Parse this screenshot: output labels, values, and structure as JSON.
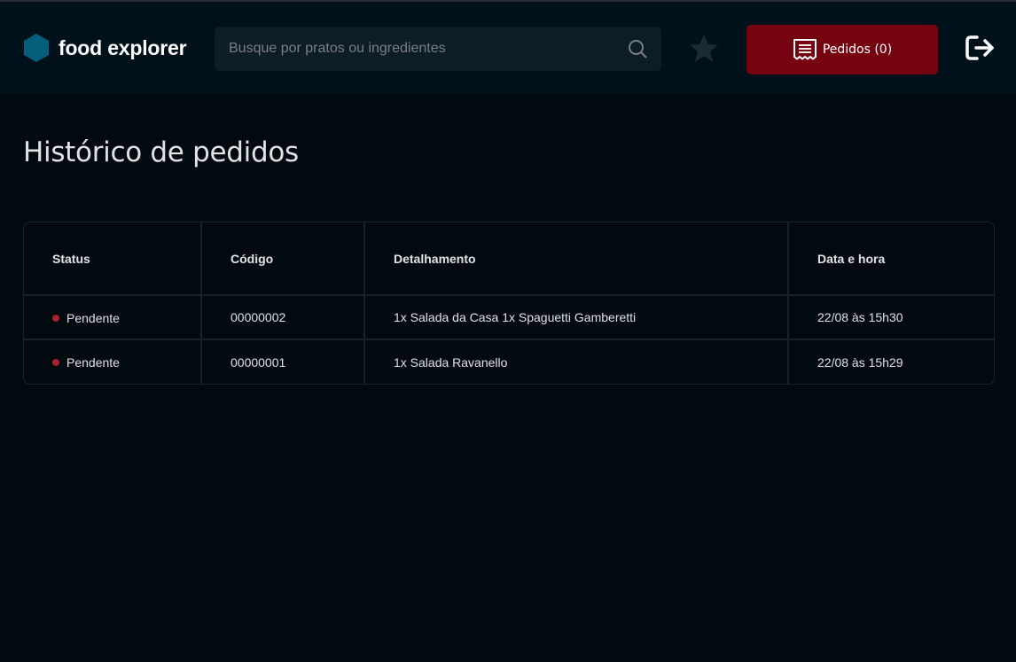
{
  "header": {
    "logo_text": "food explorer",
    "search_placeholder": "Busque por pratos ou ingredientes",
    "search_value": "",
    "orders_label": "Pedidos (0)",
    "icons": {
      "logo": "hexagon-logo-icon",
      "search": "search-icon",
      "favorites": "star-icon",
      "orders": "receipt-icon",
      "logout": "sign-out-icon"
    }
  },
  "page": {
    "title": "Histórico de pedidos"
  },
  "table": {
    "columns": [
      "Status",
      "Código",
      "Detalhamento",
      "Data e hora"
    ],
    "rows": [
      {
        "status": "Pendente",
        "status_color": "#AB222E",
        "code": "00000002",
        "detail": "1x Salada da Casa 1x Spaguetti Gamberetti",
        "datetime": "22/08 às 15h30"
      },
      {
        "status": "Pendente",
        "status_color": "#AB222E",
        "code": "00000001",
        "detail": "1x Salada Ravanello",
        "datetime": "22/08 às 15h29"
      }
    ]
  },
  "colors": {
    "background": "#000A0F",
    "header_bg": "#00111A",
    "accent_button": "#750310",
    "logo_blue": "#065E7C"
  }
}
